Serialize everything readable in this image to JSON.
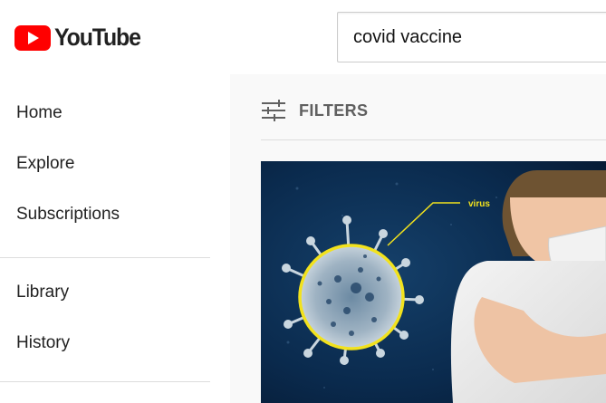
{
  "header": {
    "logo_text": "YouTube",
    "logo_icon": "youtube-play-icon",
    "brand_color": "#ff0000"
  },
  "search": {
    "value": "covid vaccine"
  },
  "sidebar": {
    "items": [
      {
        "label": "Home"
      },
      {
        "label": "Explore"
      },
      {
        "label": "Subscriptions"
      },
      {
        "label": "Library"
      },
      {
        "label": "History"
      }
    ]
  },
  "main": {
    "filters_label": "FILTERS",
    "filters_icon": "sliders-icon",
    "thumbnail": {
      "annotation_label": "virus"
    }
  }
}
